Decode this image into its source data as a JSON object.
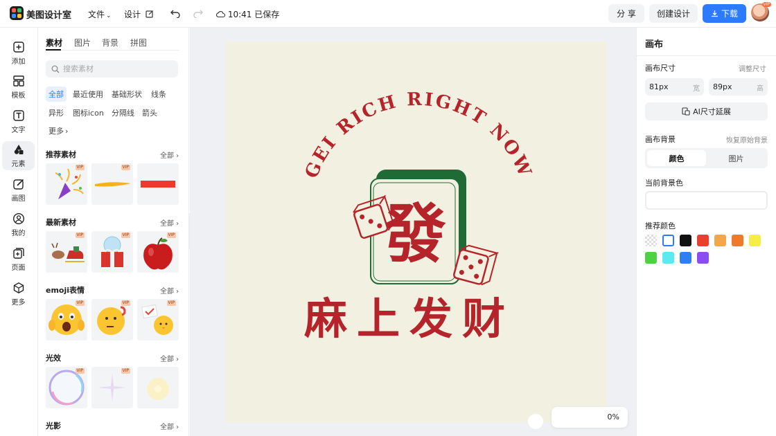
{
  "app": {
    "name": "美图设计室"
  },
  "topbar": {
    "file_menu": "文件",
    "design_menu": "设计",
    "save_status": "10:41 已保存",
    "share": "分 享",
    "create_design": "创建设计",
    "download": "下载",
    "avatar_badge": "VIP"
  },
  "leftnav": [
    {
      "label": "添加",
      "icon": "add-icon"
    },
    {
      "label": "模板",
      "icon": "template-icon"
    },
    {
      "label": "文字",
      "icon": "text-icon"
    },
    {
      "label": "元素",
      "icon": "element-icon"
    },
    {
      "label": "画图",
      "icon": "draw-icon"
    },
    {
      "label": "我的",
      "icon": "user-icon"
    },
    {
      "label": "页面",
      "icon": "page-icon"
    },
    {
      "label": "更多",
      "icon": "more-icon"
    }
  ],
  "panel": {
    "tabs": [
      "素材",
      "图片",
      "背景",
      "拼图"
    ],
    "search_placeholder": "搜索素材",
    "chips": [
      "全部",
      "最近使用",
      "基础形状",
      "线条",
      "异形",
      "图标icon",
      "分隔线",
      "箭头",
      "更多"
    ],
    "all_label": "全部",
    "vip_label": "VIP",
    "sections": [
      {
        "title": "推荐素材",
        "thumbs": [
          "party-popper",
          "yellow-stroke",
          "red-bar"
        ]
      },
      {
        "title": "最新素材",
        "thumbs": [
          "reindeer-sleigh",
          "snow-globe-gift",
          "red-apple"
        ]
      },
      {
        "title": "emoji表情",
        "thumbs": [
          "shocked-emoji",
          "thinking-emoji",
          "chick-emoji"
        ]
      },
      {
        "title": "光效",
        "thumbs": [
          "bubble",
          "sparkle",
          "glow"
        ]
      },
      {
        "title": "光影",
        "thumbs": []
      }
    ]
  },
  "canvas": {
    "arc_text": "GEI RICH RIGHT NOW",
    "tile_char": "發",
    "main_text": "麻上发财",
    "background_color": "#f2f0e0",
    "accent_red": "#b5242a",
    "tile_green": "#1e6b35",
    "zoom_text": "0%"
  },
  "rpanel": {
    "title": "画布",
    "size_label": "画布尺寸",
    "adjust_link": "调整尺寸",
    "width_value": "81px",
    "width_unit": "宽",
    "height_value": "89px",
    "height_unit": "高",
    "ai_extend": "AI尺寸延展",
    "bg_label": "画布背景",
    "restore_link": "恢复原始背景",
    "seg_color": "颜色",
    "seg_image": "图片",
    "current_bg_label": "当前背景色",
    "recommended_label": "推荐颜色",
    "swatches": [
      "transparent",
      "#ffffff",
      "#111111",
      "#e8402c",
      "#f5a54a",
      "#f07a2b",
      "#f7ee45",
      "#4fd146",
      "#5ceaf2",
      "#2e7ff0",
      "#8a4df0"
    ]
  }
}
